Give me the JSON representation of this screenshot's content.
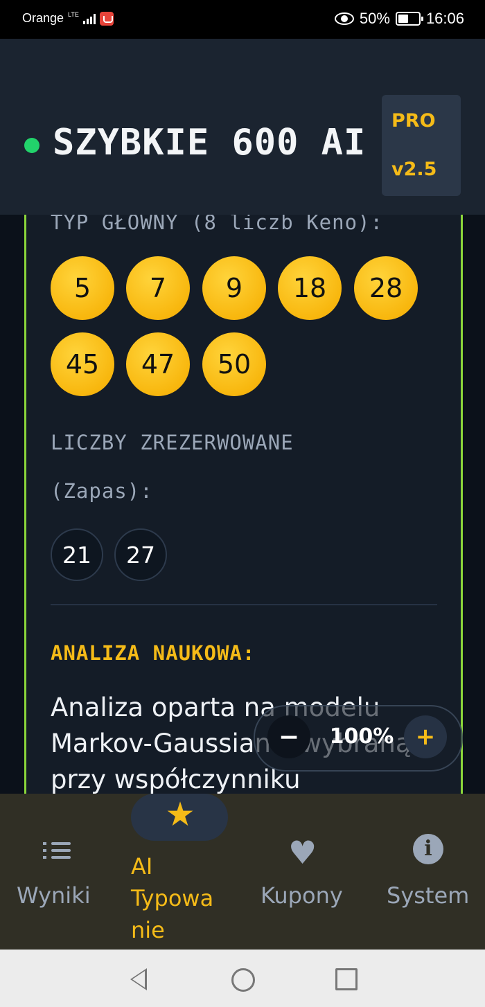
{
  "status_bar": {
    "carrier": "Orange",
    "network": "LTE",
    "battery": "50%",
    "time": "16:06"
  },
  "header": {
    "title": "SZYBKIE 600 AI",
    "badge_line1": "PRO",
    "badge_line2": "v2.5"
  },
  "main": {
    "main_label": "TYP GŁÓWNY (8 liczb Keno):",
    "main_numbers": [
      "5",
      "7",
      "9",
      "18",
      "28",
      "45",
      "47",
      "50"
    ],
    "reserve_label_line1": "LICZBY ZREZERWOWANE",
    "reserve_label_line2": "(Zapas):",
    "reserve_numbers": [
      "21",
      "27"
    ],
    "analysis_title": "ANALIZA NAUKOWA:",
    "analysis_text": "Analiza oparta na modelu Markov-Gaussian z wybraną przy współczynniku hotColdRatio"
  },
  "zoom": {
    "minus": "−",
    "value": "100%",
    "plus": "+"
  },
  "bottom_nav": {
    "items": [
      {
        "label": "Wyniki",
        "icon": "list-icon"
      },
      {
        "label": "AI Typowanie",
        "icon": "star-icon",
        "active": true
      },
      {
        "label": "Kupony",
        "icon": "heart-icon"
      },
      {
        "label": "System",
        "icon": "info-icon"
      }
    ],
    "ai_line1": "AI",
    "ai_line2": "Typowa",
    "ai_line3": "nie"
  },
  "colors": {
    "accent": "#f5bb18",
    "ball": "#f8b70e",
    "card_border": "#8bd63a",
    "online_dot": "#22d36b"
  }
}
